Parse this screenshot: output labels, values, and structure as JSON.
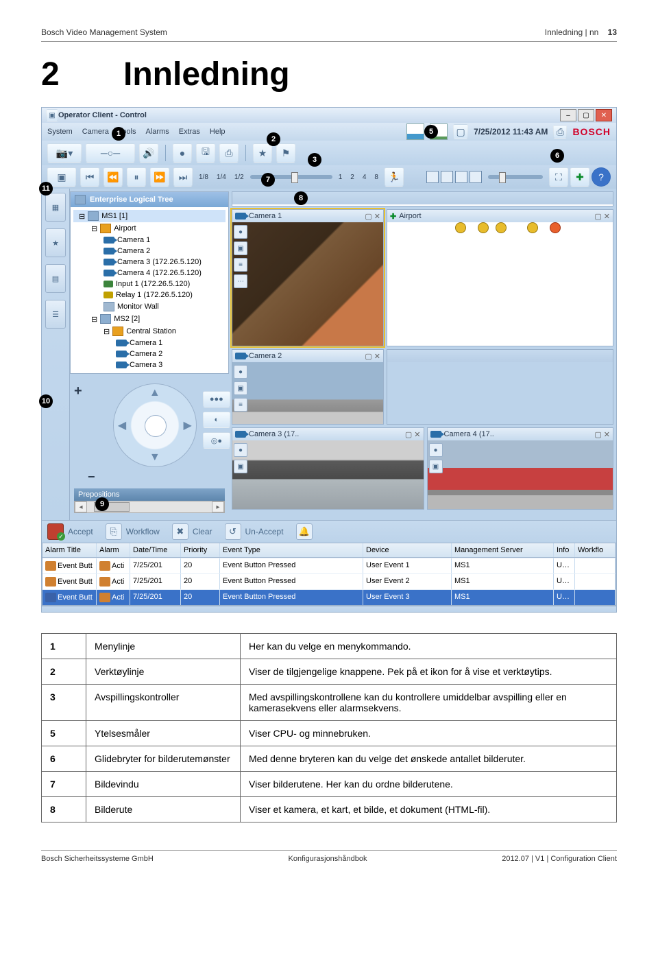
{
  "header": {
    "doc_title": "Bosch Video Management System",
    "breadcrumb": "Innledning | nn",
    "page_no": "13"
  },
  "chapter": {
    "number": "2",
    "title": "Innledning"
  },
  "app": {
    "window_title": "Operator Client - Control",
    "menu": [
      "System",
      "Camera",
      "Tools",
      "Alarms",
      "Extras",
      "Help"
    ],
    "timestamp": "7/25/2012 11:43 AM",
    "brand": "BOSCH",
    "playback_speeds": [
      "1/8",
      "1/4",
      "1/2",
      "1",
      "2",
      "4",
      "8"
    ],
    "tree_title": "Enterprise Logical Tree",
    "tree": {
      "ms1": "MS1 [1]",
      "airport": "Airport",
      "cam1": "Camera 1",
      "cam2": "Camera 2",
      "cam3": "Camera 3 (172.26.5.120)",
      "cam4": "Camera 4 (172.26.5.120)",
      "input1": "Input 1 (172.26.5.120)",
      "relay1": "Relay 1 (172.26.5.120)",
      "monwall": "Monitor Wall",
      "ms2": "MS2 [2]",
      "central": "Central Station",
      "c1": "Camera 1",
      "c2": "Camera 2",
      "c3": "Camera 3"
    },
    "prepositions_label": "Prepositions",
    "panes": {
      "p1": "Camera 1",
      "p2": "Airport",
      "p3": "Camera 2",
      "p4": "Camera 3 (17..",
      "p5": "Camera 4 (17.."
    },
    "bottom_actions": {
      "accept": "Accept",
      "workflow": "Workflow",
      "clear": "Clear",
      "unaccept": "Un-Accept"
    },
    "alarm_headers": {
      "title": "Alarm Title",
      "alarm": "Alarm",
      "datetime": "Date/Time",
      "priority": "Priority",
      "event": "Event Type",
      "device": "Device",
      "mgmt": "Management Server",
      "info": "Info",
      "wf": "Workflo"
    },
    "alarm_rows": [
      {
        "title": "Event Butt",
        "alarm": "Acti",
        "dt": "7/25/201",
        "pr": "20",
        "ev": "Event Button Pressed",
        "dev": "User Event 1",
        "ms": "MS1",
        "info": "User manually triggered event"
      },
      {
        "title": "Event Butt",
        "alarm": "Acti",
        "dt": "7/25/201",
        "pr": "20",
        "ev": "Event Button Pressed",
        "dev": "User Event 2",
        "ms": "MS1",
        "info": "User manually triggered event"
      },
      {
        "title": "Event Butt",
        "alarm": "Acti",
        "dt": "7/25/201",
        "pr": "20",
        "ev": "Event Button Pressed",
        "dev": "User Event 3",
        "ms": "MS1",
        "info": "User manually triggered event"
      }
    ]
  },
  "legend": [
    {
      "n": "1",
      "label": "Menylinje",
      "desc": "Her kan du velge en menykommando."
    },
    {
      "n": "2",
      "label": "Verktøylinje",
      "desc": "Viser de tilgjengelige knappene. Pek på et ikon for å vise et verktøytips."
    },
    {
      "n": "3",
      "label": "Avspillingskontroller",
      "desc": "Med avspillingskontrollene kan du kontrollere umiddelbar avspilling eller en kamerasekvens eller alarmsekvens."
    },
    {
      "n": "5",
      "label": "Ytelsesmåler",
      "desc": "Viser CPU- og minnebruken."
    },
    {
      "n": "6",
      "label": "Glidebryter for bilderutemønster",
      "desc": "Med denne bryteren kan du velge det ønskede antallet bilderuter."
    },
    {
      "n": "7",
      "label": "Bildevindu",
      "desc": "Viser bilderutene. Her kan du ordne bilderutene."
    },
    {
      "n": "8",
      "label": "Bilderute",
      "desc": "Viser et kamera, et kart, et bilde, et dokument (HTML-fil)."
    }
  ],
  "footer": {
    "left": "Bosch Sicherheitssysteme GmbH",
    "mid": "Konfigurasjonshåndbok",
    "right": "2012.07 | V1 | Configuration Client"
  }
}
